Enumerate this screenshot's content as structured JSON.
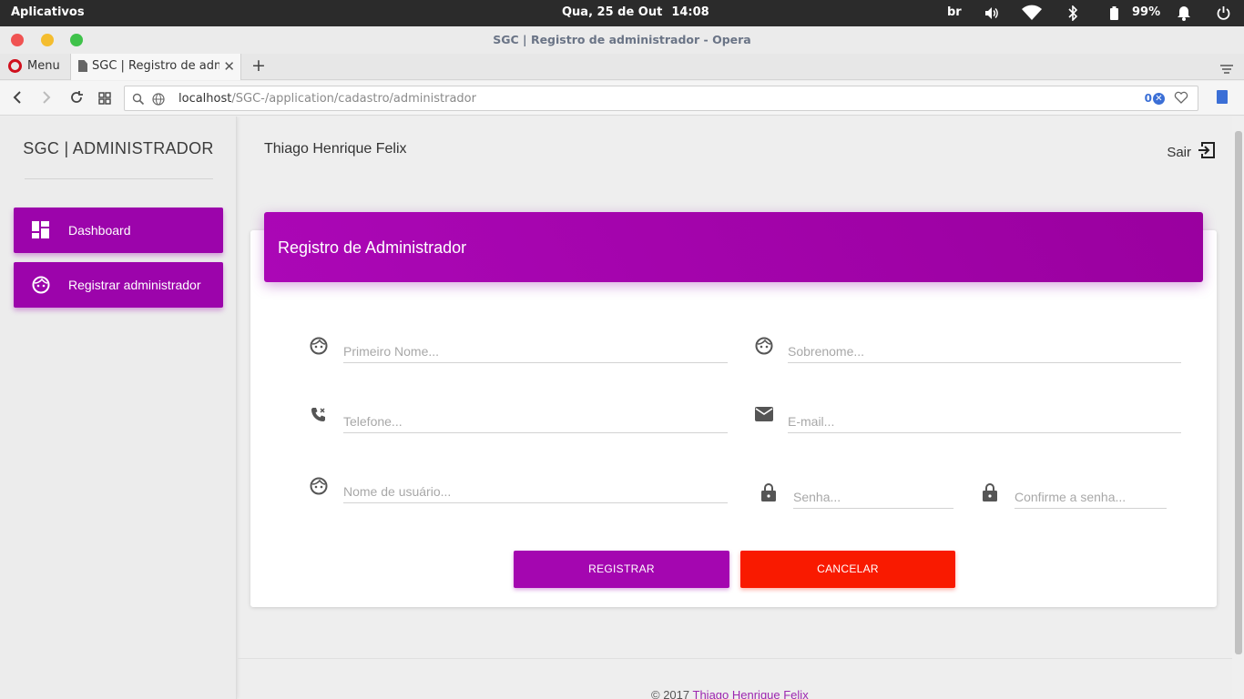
{
  "os_bar": {
    "apps_label": "Aplicativos",
    "date": "Qua, 25 de Out",
    "time": "14:08",
    "keyboard_layout": "br",
    "battery": "99%"
  },
  "window": {
    "title": "SGC | Registro de administrador - Opera"
  },
  "tabs": {
    "menu_label": "Menu",
    "active_tab_label": "SGC | Registro de administrador",
    "new_tab": "+"
  },
  "address_bar": {
    "host": "localhost",
    "path": "/SGC-/application/cadastro/administrador",
    "blocked_count": "0"
  },
  "sidebar": {
    "brand": "SGC | ADMINISTRADOR",
    "items": [
      {
        "label": "Dashboard",
        "icon": "dashboard-icon"
      },
      {
        "label": "Registrar administrador",
        "icon": "face-icon"
      }
    ]
  },
  "header": {
    "user_name": "Thiago Henrique Felix",
    "logout_label": "Sair"
  },
  "form": {
    "title": "Registro de Administrador",
    "fields": {
      "first_name": {
        "placeholder": "Primeiro Nome...",
        "icon": "face-icon"
      },
      "last_name": {
        "placeholder": "Sobrenome...",
        "icon": "face-icon"
      },
      "phone": {
        "placeholder": "Telefone...",
        "icon": "phone-icon"
      },
      "email": {
        "placeholder": "E-mail...",
        "icon": "mail-icon"
      },
      "username": {
        "placeholder": "Nome de usuário...",
        "icon": "face-icon"
      },
      "password": {
        "placeholder": "Senha...",
        "icon": "lock-icon"
      },
      "confirm_password": {
        "placeholder": "Confirme a senha...",
        "icon": "lock-icon"
      }
    },
    "register_label": "REGISTRAR",
    "cancel_label": "CANCELAR"
  },
  "footer": {
    "copyright": "© 2017",
    "author_link": "Thiago Henrique Felix"
  },
  "colors": {
    "accent": "#9c04ab",
    "danger": "#f91a00"
  }
}
